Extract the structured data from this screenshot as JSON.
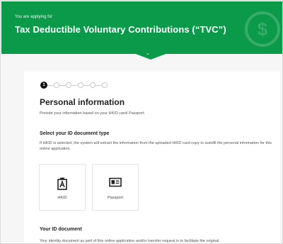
{
  "banner": {
    "subtitle": "You are applying for",
    "title": "Tax Deductible Voluntary Contributions (“TVC”)",
    "coin_symbol": "$",
    "accent_color": "#0b9a4a"
  },
  "steps": {
    "current": 1,
    "total": 6,
    "current_label": "1"
  },
  "personal": {
    "heading": "Personal information",
    "description": "Provide your information based on your HKID card/ Passport."
  },
  "id_type": {
    "heading": "Select your ID document type",
    "note": "If HKID is selected, the system will extract the information from the uploaded HKID card copy to autofill the personal information for this online application.",
    "options": [
      {
        "label": "HKID",
        "icon": "id-card-icon"
      },
      {
        "label": "Passport",
        "icon": "passport-icon"
      }
    ]
  },
  "your_id": {
    "heading": "Your ID document",
    "note": "Your identity document as part of this online application and/or transfer request is to facilitate the original"
  }
}
